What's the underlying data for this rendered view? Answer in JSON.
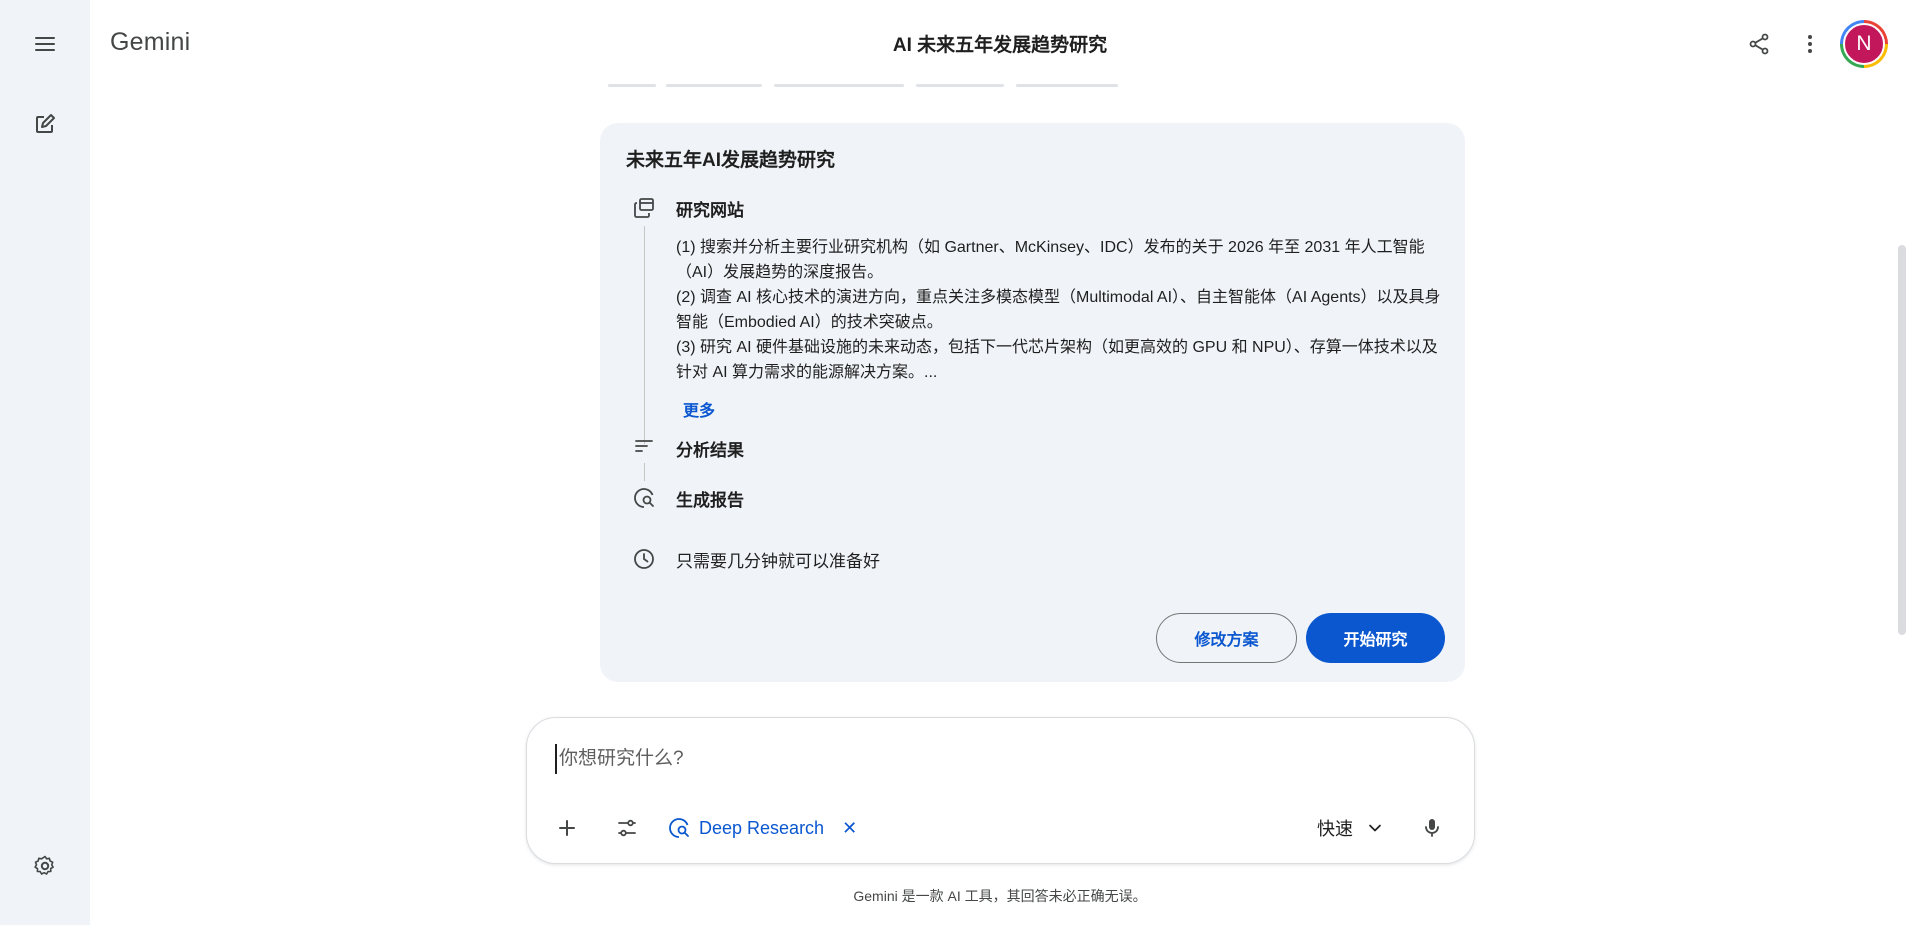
{
  "app": {
    "brand": "Gemini",
    "conversation_title": "AI 未来五年发展趋势研究"
  },
  "user": {
    "avatar_initial": "N"
  },
  "plan": {
    "title": "未来五年AI发展趋势研究",
    "steps": [
      {
        "label": "研究网站",
        "icon": "web-pages-icon"
      },
      {
        "label": "分析结果",
        "icon": "sort-lines-icon"
      },
      {
        "label": "生成报告",
        "icon": "deep-research-icon"
      }
    ],
    "details": [
      "(1) 搜索并分析主要行业研究机构（如 Gartner、McKinsey、IDC）发布的关于 2026 年至 2031 年人工智能（AI）发展趋势的深度报告。",
      "(2) 调查 AI 核心技术的演进方向，重点关注多模态模型（Multimodal AI）、自主智能体（AI Agents）以及具身智能（Embodied AI）的技术突破点。",
      "(3) 研究 AI 硬件基础设施的未来动态，包括下一代芯片架构（如更高效的 GPU 和 NPU）、存算一体技术以及针对 AI 算力需求的能源解决方案。..."
    ],
    "more_label": "更多",
    "time_note": "只需要几分钟就可以准备好",
    "edit_button": "修改方案",
    "start_button": "开始研究"
  },
  "composer": {
    "placeholder": "你想研究什么?",
    "tool_chip": "Deep Research",
    "chip_close": "✕",
    "model_label": "快速"
  },
  "disclaimer": "Gemini 是一款 AI 工具，其回答未必正确无误。",
  "colors": {
    "accent": "#0b57d0",
    "rail_bg": "#f0f4f9",
    "card_bg": "#f0f4f9",
    "avatar_bg": "#c2185b"
  }
}
